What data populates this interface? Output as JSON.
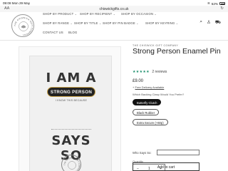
{
  "status_bar": {
    "time": "09:08",
    "date": "Mon 29 May",
    "battery": "52%"
  },
  "browser": {
    "url": "chiswickgifts.co.uk",
    "text_size": "AA",
    "reload_icon": "reload-icon"
  },
  "header": {
    "logo_text": "THE CHISWICK GIFT COMPANY",
    "nav": [
      {
        "label": "SHOP BY PRODUCT",
        "has_dropdown": true
      },
      {
        "label": "SHOP BY RECIPIENT",
        "has_dropdown": true
      },
      {
        "label": "SHOP BY OCCASION",
        "has_dropdown": true
      },
      {
        "label": "SHOP BY RANGE",
        "has_dropdown": true
      },
      {
        "label": "SHOP BY TITLE",
        "has_dropdown": true
      },
      {
        "label": "SHOP BY PIN BADGE",
        "has_dropdown": true
      },
      {
        "label": "SHOP BY KEYRING",
        "has_dropdown": true
      },
      {
        "label": "CONTACT US",
        "has_dropdown": false
      },
      {
        "label": "BLOG",
        "has_dropdown": false
      }
    ],
    "icons": [
      "search-icon",
      "account-icon",
      "cart-icon"
    ]
  },
  "product_image": {
    "line1": "I AM A",
    "badge": "STRONG PERSON",
    "small": "I KNOW THIS BECAUSE",
    "line2": "SAYS SO",
    "seal_text": "THE CHISWICK GIFT COMPANY"
  },
  "product": {
    "brand": "THE CHISWICK GIFT COMPANY",
    "title": "Strong Person Enamel Pin",
    "rating_stars": "★★★★★",
    "review_count": "2 reviews",
    "price": "£9.00",
    "delivery_prefix": "+",
    "delivery_text": "Free Delivery Available",
    "option_label": "Which Backing Clasp Would You Prefer?",
    "options": [
      {
        "label": "Butterfly Clutch",
        "selected": true
      },
      {
        "label": "Black Rubber",
        "selected": false
      },
      {
        "label": "Extra Secure (+60p)",
        "selected": false
      }
    ],
    "who_label": "Who Says So:",
    "who_value": "",
    "quantity_label": "Quantity",
    "quantity_minus": "−",
    "quantity_value": "1",
    "quantity_plus": "+",
    "add_to_cart": "Add to cart"
  },
  "colors": {
    "accent_green": "#1b8e6b",
    "selected_pill": "#111111",
    "badge_gold": "#c8a24a"
  }
}
